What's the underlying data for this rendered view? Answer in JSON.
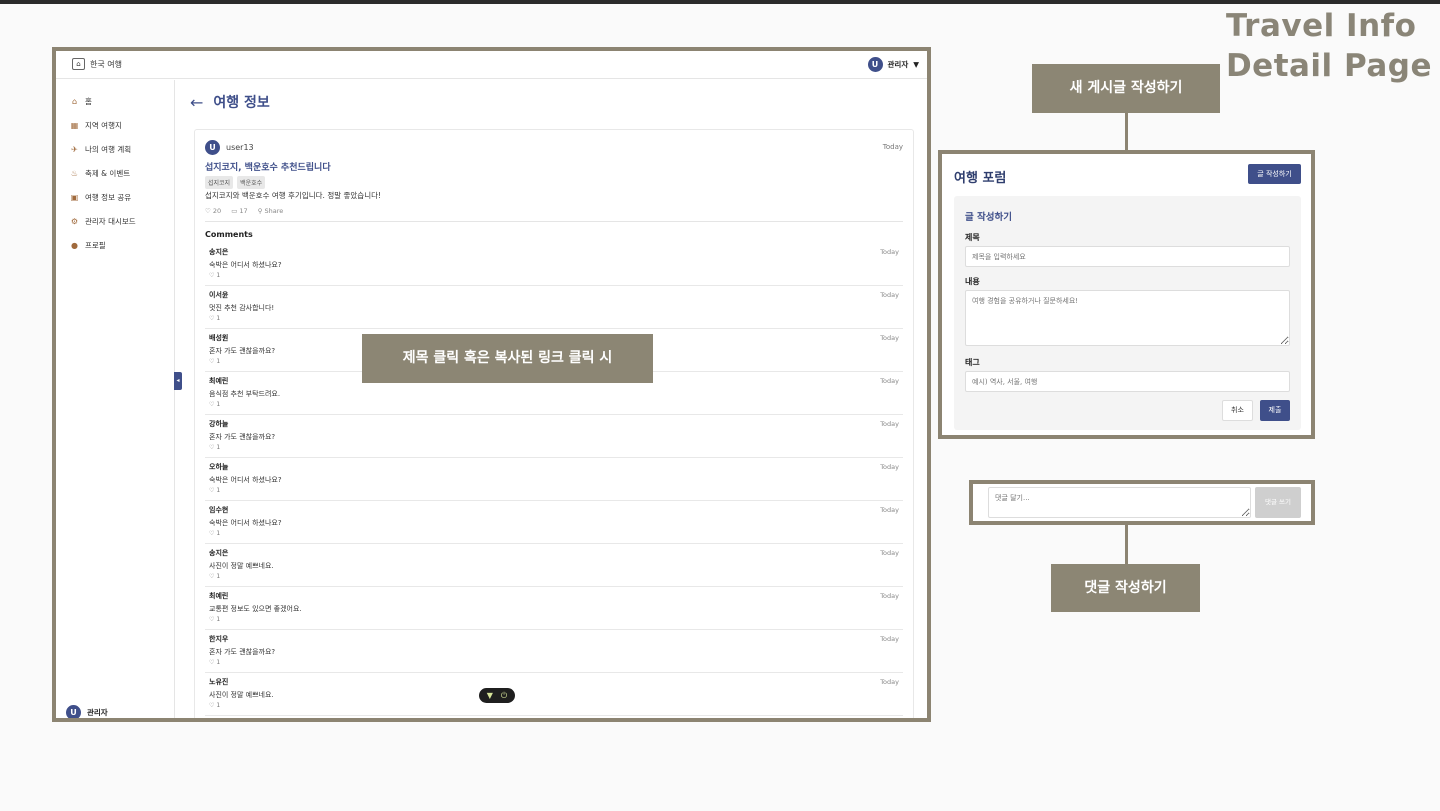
{
  "page": {
    "title_line1": "Travel Info",
    "title_line2": "Detail Page"
  },
  "app": {
    "logo_text": "한국 여행",
    "user_initial": "U",
    "user_name": "관리자",
    "user_menu_caret": "▼"
  },
  "sidebar": {
    "items": [
      {
        "icon": "home-icon",
        "glyph": "⌂",
        "label": "홈"
      },
      {
        "icon": "map-icon",
        "glyph": "▦",
        "label": "지역 여행지"
      },
      {
        "icon": "plane-icon",
        "glyph": "✈",
        "label": "나의 여행 계획"
      },
      {
        "icon": "fire-icon",
        "glyph": "♨",
        "label": "축제 & 이벤트"
      },
      {
        "icon": "share-icon",
        "glyph": "▣",
        "label": "여행 정보 공유"
      },
      {
        "icon": "gear-icon",
        "glyph": "⚙",
        "label": "관리자 대시보드"
      },
      {
        "icon": "person-icon",
        "glyph": "●",
        "label": "프로필"
      }
    ],
    "footer_initial": "U",
    "footer_name": "관리자",
    "collapse_glyph": "◂"
  },
  "content": {
    "back_arrow": "←",
    "page_title": "여행 정보"
  },
  "post": {
    "author_initial": "U",
    "author": "user13",
    "date": "Today",
    "title": "섭지코지, 백운호수 추천드립니다",
    "tags": [
      "섭지코지",
      "백운호수"
    ],
    "body": "섭지코지와 백운호수 여행 후기입니다. 정말 좋았습니다!",
    "likes": "20",
    "comments_count": "17",
    "share_label": "Share"
  },
  "comments": {
    "heading": "Comments",
    "items": [
      {
        "author": "송지은",
        "text": "숙박은 어디서 하셨나요?",
        "likes": "1",
        "date": "Today"
      },
      {
        "author": "이서윤",
        "text": "멋진 추천 감사합니다!",
        "likes": "1",
        "date": "Today"
      },
      {
        "author": "배성원",
        "text": "혼자 가도 괜찮을까요?",
        "likes": "1",
        "date": "Today"
      },
      {
        "author": "최예린",
        "text": "음식점 추천 부탁드려요.",
        "likes": "1",
        "date": "Today"
      },
      {
        "author": "강하늘",
        "text": "혼자 가도 괜찮을까요?",
        "likes": "1",
        "date": "Today"
      },
      {
        "author": "오하늘",
        "text": "숙박은 어디서 하셨나요?",
        "likes": "1",
        "date": "Today"
      },
      {
        "author": "임수현",
        "text": "숙박은 어디서 하셨나요?",
        "likes": "1",
        "date": "Today"
      },
      {
        "author": "송지은",
        "text": "사진이 정말 예쁘네요.",
        "likes": "1",
        "date": "Today"
      },
      {
        "author": "최예린",
        "text": "교통편 정보도 있으면 좋겠어요.",
        "likes": "1",
        "date": "Today"
      },
      {
        "author": "한지우",
        "text": "혼자 가도 괜찮을까요?",
        "likes": "1",
        "date": "Today"
      },
      {
        "author": "노유진",
        "text": "사진이 정말 예쁘네요.",
        "likes": "1",
        "date": "Today"
      }
    ]
  },
  "annotations": {
    "click_title": "제목 클릭 혹은 복사된 링크 클릭 시",
    "new_post": "새 게시글 작성하기",
    "write_comment": "댓글 작성하기"
  },
  "forum": {
    "title": "여행 포럼",
    "write_button": "글 작성하기",
    "form_heading": "글 작성하기",
    "title_label": "제목",
    "title_placeholder": "제목을 입력하세요",
    "content_label": "내용",
    "content_placeholder": "여행 경험을 공유하거나 질문하세요!",
    "tags_label": "태그",
    "tags_placeholder": "예시) 역사, 서울, 여행",
    "cancel_button": "취소",
    "submit_button": "제출"
  },
  "comment_box": {
    "placeholder": "댓글 달기...",
    "submit_button": "댓글 쓰기"
  },
  "colors": {
    "accent": "#3f4f8a",
    "frame": "#8c8472",
    "callout": "#8c8674"
  }
}
